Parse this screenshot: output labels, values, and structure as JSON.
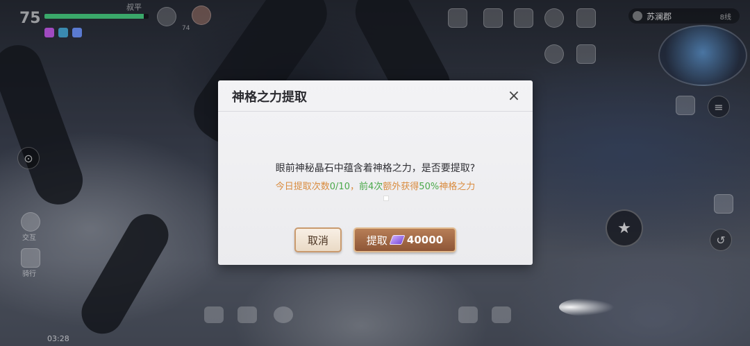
{
  "hud": {
    "level": "75",
    "player_name": "叔平",
    "hp_fraction": 0.95,
    "time": "03:28",
    "sub_level": "74"
  },
  "location": {
    "name": "苏澜郡",
    "channel": "8线"
  },
  "side_buttons": {
    "interact": "交互",
    "ride": "骑行"
  },
  "dialog": {
    "title": "神格之力提取",
    "close_icon": "×",
    "message": "眼前神秘晶石中蕴含着神格之力，是否要提取?",
    "info_part1": "今日提取次数",
    "info_count": "0/10",
    "info_sep": "，",
    "info_part2": "前4次",
    "info_part3": "额外获得",
    "info_part4": "50%",
    "info_part5": "神格之力",
    "cancel_label": "取消",
    "extract_label": "提取",
    "extract_cost": "40000"
  },
  "colors": {
    "accent_orange": "#d98b3e",
    "accent_green": "#4aa84a",
    "button_brown": "#8e5637"
  }
}
